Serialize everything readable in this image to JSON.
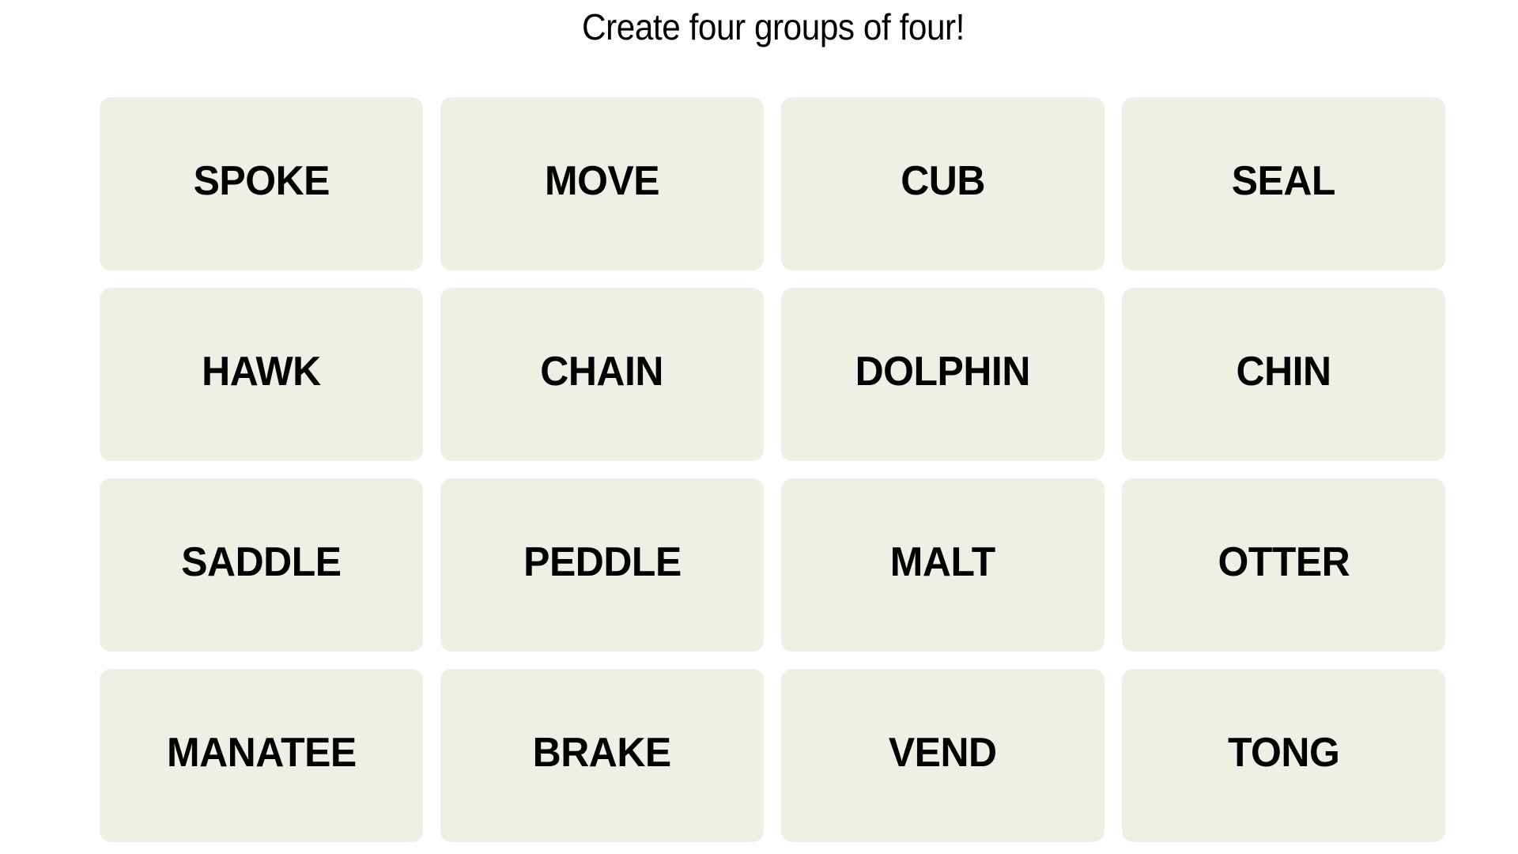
{
  "header": {
    "instruction": "Create four groups of four!"
  },
  "board": {
    "tile_color": "#efefe6",
    "text_color": "#000000",
    "tiles": [
      {
        "label": "SPOKE"
      },
      {
        "label": "MOVE"
      },
      {
        "label": "CUB"
      },
      {
        "label": "SEAL"
      },
      {
        "label": "HAWK"
      },
      {
        "label": "CHAIN"
      },
      {
        "label": "DOLPHIN"
      },
      {
        "label": "CHIN"
      },
      {
        "label": "SADDLE"
      },
      {
        "label": "PEDDLE"
      },
      {
        "label": "MALT"
      },
      {
        "label": "OTTER"
      },
      {
        "label": "MANATEE"
      },
      {
        "label": "BRAKE"
      },
      {
        "label": "VEND"
      },
      {
        "label": "TONG"
      }
    ]
  }
}
